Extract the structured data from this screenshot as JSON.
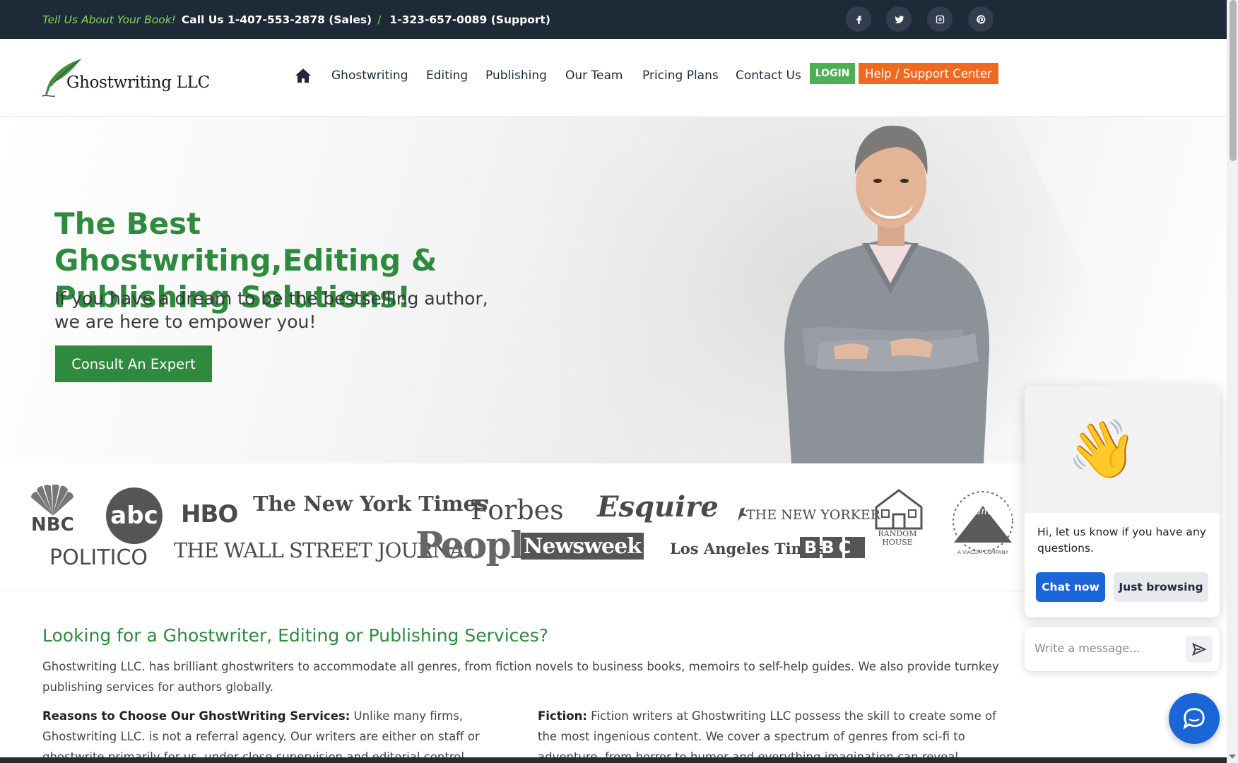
{
  "topbar": {
    "tell": "Tell Us About Your Book!",
    "call": "Call Us 1-407-553-2878 (Sales)",
    "slash": "/",
    "support": "1-323-657-0089 (Support)",
    "social": [
      "facebook-icon",
      "twitter-icon",
      "instagram-icon",
      "pinterest-icon"
    ]
  },
  "logo": {
    "text": "Ghostwriting LLC"
  },
  "nav": {
    "items": [
      "Ghostwriting",
      "Editing",
      "Publishing",
      "Our Team",
      "Pricing Plans",
      "Contact Us"
    ],
    "login": "LOGIN",
    "support": "Help / Support Center"
  },
  "hero": {
    "title": "The Best Ghostwriting,Editing & Publishing Solutions!",
    "subtitle": "If you have a dream to be the bestselling author, we are here to empower you!",
    "cta": "Consult An Expert"
  },
  "logos": [
    "NBC",
    "abc",
    "HBO",
    "The New York Times",
    "Forbes",
    "Esquire",
    "THE NEW YORKER",
    "RANDOM HOUSE",
    "Paramount",
    "A VIACOM COMPANY",
    "POLITICO",
    "THE WALL STREET JOURNAL",
    "People",
    "Newsweek",
    "Los Angeles Times",
    "BBC"
  ],
  "content": {
    "title": "Looking for a Ghostwriter, Editing or Publishing Services?",
    "intro": "Ghostwriting LLC. has brilliant ghostwriters to accommodate all genres, from fiction novels to business books, memoirs to self-help guides. We also provide turnkey publishing services for authors globally.",
    "col1_heading": "Reasons to Choose Our GhostWriting Services:",
    "col1_text": " Unlike many firms, Ghostwriting LLC. is not a referral agency. Our writers are either on staff or ghostwrite primarily for us, under close supervision and editorial control. Ghostwriting LLC. is certainly",
    "col2_heading": "Fiction:",
    "col2_text": " Fiction writers at Ghostwriting LLC possess the skill to create some of the most ingenious content. We cover a spectrum of genres from sci-fi to adventure, from horror to humor and everything imagination can reveal."
  },
  "chat": {
    "message": "Hi, let us know if you have any questions.",
    "chat_now": "Chat now",
    "just_browsing": "Just browsing",
    "placeholder": "Write a message..."
  },
  "colors": {
    "brand_green": "#2e8b3e",
    "accent_orange": "#ef6a1f",
    "topbar_bg": "#1f2a38",
    "chat_blue": "#1a66d6"
  }
}
